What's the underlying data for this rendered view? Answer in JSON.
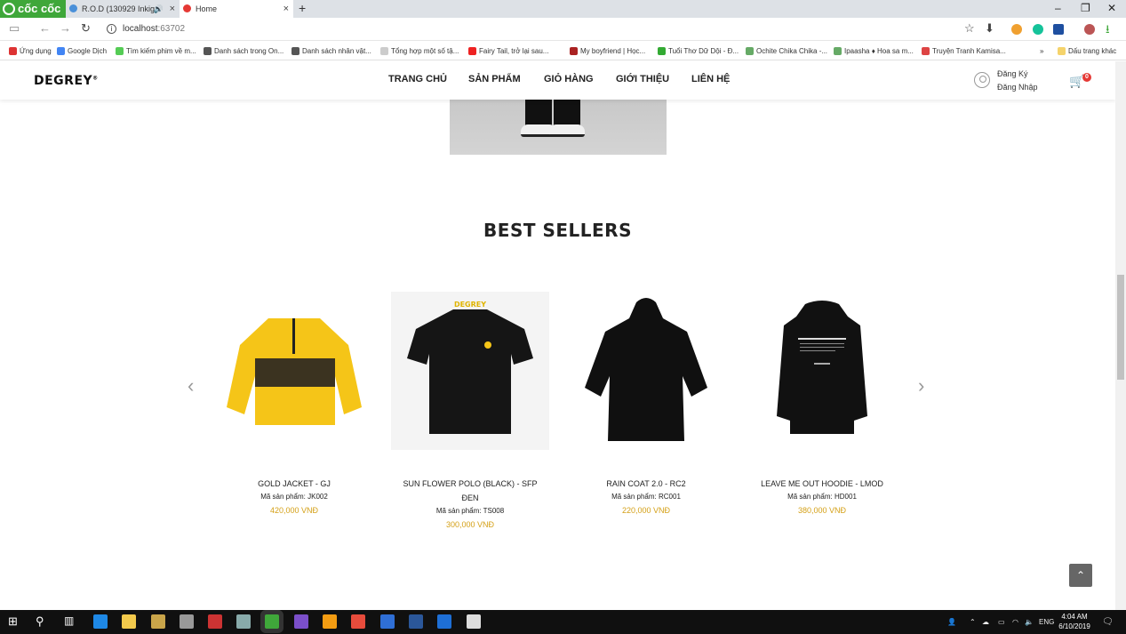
{
  "browser": {
    "brand": "cốc cốc",
    "tabs": [
      {
        "title": "R.O.D (130929 Inkiga"
      },
      {
        "title": "Home"
      }
    ],
    "new_tab": "+",
    "window_controls": [
      "–",
      "❐",
      "✕"
    ],
    "url_host": "localhost",
    "url_port": ":63702",
    "bookmarks": [
      "Ứng dụng",
      "Google Dịch",
      "Tìm kiếm phim về m...",
      "Danh sách trong On...",
      "Danh sách nhân vật...",
      "Tổng hợp một số tậ...",
      "Fairy Tail, trở lại sau...",
      "My boyfriend | Học...",
      "Tuổi Thơ Dữ Dội - Đ...",
      "Ochite Chika Chika -...",
      "Ipaasha ♦ Hoa sa m...",
      "Truyện Tranh Kamisa...",
      "»",
      "Dấu trang khác"
    ]
  },
  "site": {
    "logo": "DEGREY",
    "logo_mark": "®",
    "menu": [
      "TRANG CHỦ",
      "SẢN PHẨM",
      "GIỎ HÀNG",
      "GIỚI THIỆU",
      "LIÊN HỆ"
    ],
    "auth": {
      "register": "Đăng Ký",
      "login": "Đăng Nhập"
    },
    "cart_count": "0"
  },
  "best_sellers": {
    "title": "BEST SELLERS",
    "prev": "‹",
    "next": "›",
    "products": [
      {
        "name": "GOLD JACKET - GJ",
        "code": "Mã sản phẩm: JK002",
        "price": "420,000 VNĐ"
      },
      {
        "name": "SUN FLOWER POLO (BLACK) - SFP ĐEN",
        "code": "Mã sản phẩm: TS008",
        "price": "300,000 VNĐ"
      },
      {
        "name": "RAIN COAT 2.0 - RC2",
        "code": "Mã sản phẩm: RC001",
        "price": "220,000 VNĐ"
      },
      {
        "name": "LEAVE ME OUT HOODIE - LMOD",
        "code": "Mã sản phẩm: HD001",
        "price": "380,000 VNĐ"
      }
    ]
  },
  "to_top": "⌃",
  "taskbar": {
    "lang": "ENG",
    "time": "4:04 AM",
    "date": "6/10/2019"
  },
  "colors": {
    "price": "#d4a017",
    "brand_green": "#3fa73a",
    "badge": "#e53935"
  }
}
